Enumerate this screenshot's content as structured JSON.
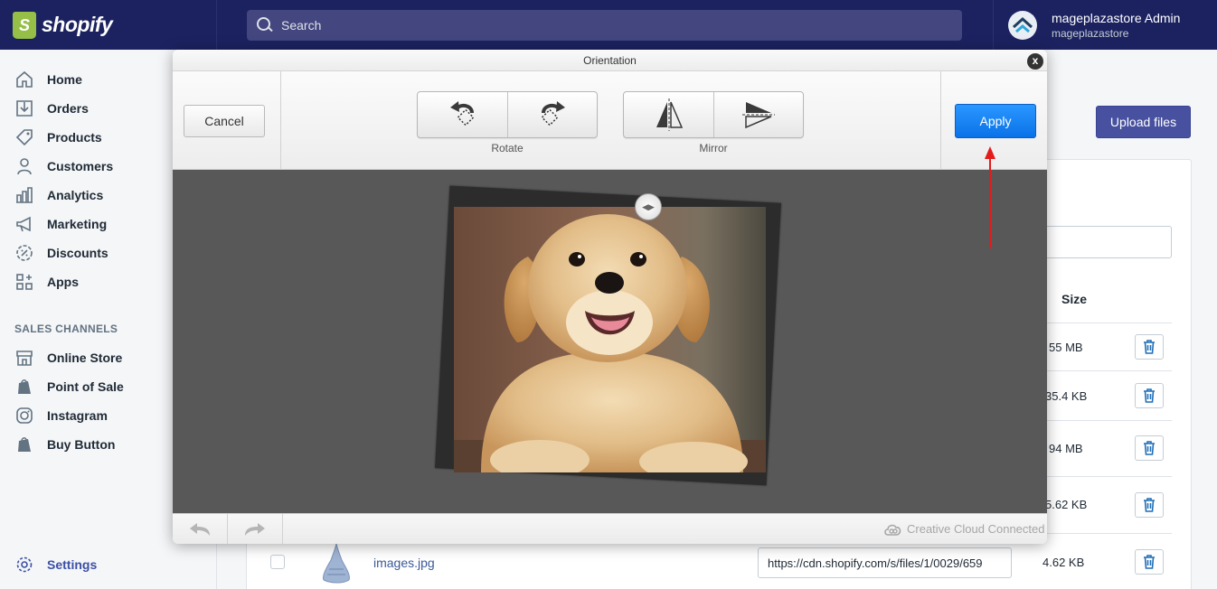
{
  "topbar": {
    "brand": "shopify",
    "search_placeholder": "Search",
    "account_name": "mageplazastore Admin",
    "account_store": "mageplazastore"
  },
  "sidebar": {
    "items": [
      {
        "label": "Home",
        "icon": "home-icon"
      },
      {
        "label": "Orders",
        "icon": "orders-icon"
      },
      {
        "label": "Products",
        "icon": "tag-icon"
      },
      {
        "label": "Customers",
        "icon": "person-icon"
      },
      {
        "label": "Analytics",
        "icon": "bar-chart-icon"
      },
      {
        "label": "Marketing",
        "icon": "megaphone-icon"
      },
      {
        "label": "Discounts",
        "icon": "discount-icon"
      },
      {
        "label": "Apps",
        "icon": "apps-icon"
      }
    ],
    "section_title": "SALES CHANNELS",
    "channels": [
      {
        "label": "Online Store",
        "icon": "store-icon"
      },
      {
        "label": "Point of Sale",
        "icon": "shopify-bag-icon"
      },
      {
        "label": "Instagram",
        "icon": "instagram-icon"
      },
      {
        "label": "Buy Button",
        "icon": "shopify-bag-icon"
      }
    ],
    "settings": "Settings"
  },
  "page": {
    "upload_label": "Upload files",
    "size_header": "Size",
    "sizes": [
      "55 MB",
      "35.4 KB",
      "94 MB",
      "5.62 KB"
    ],
    "last_row": {
      "filename": "images.jpg",
      "url": "https://cdn.shopify.com/s/files/1/0029/659",
      "size": "4.62 KB"
    }
  },
  "modal": {
    "title": "Orientation",
    "close": "x",
    "cancel_label": "Cancel",
    "rotate_label": "Rotate",
    "mirror_label": "Mirror",
    "apply_label": "Apply",
    "footer_status": "Creative Cloud Connected"
  },
  "colors": {
    "topbar": "#1c2260",
    "apply": "#1284f5",
    "annotation_arrow": "#e31b1b"
  }
}
